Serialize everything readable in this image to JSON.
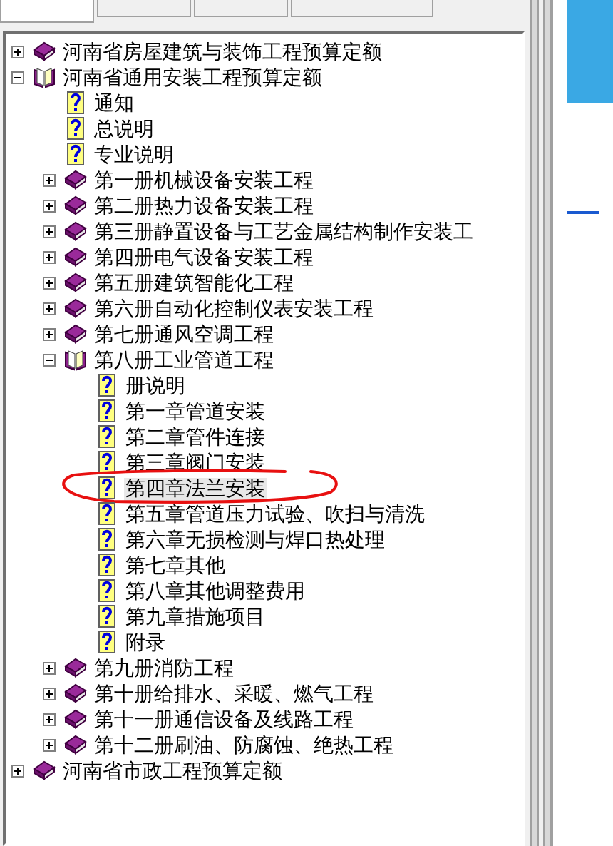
{
  "tabs": [
    {
      "selected": true
    },
    {
      "selected": false
    },
    {
      "selected": false
    },
    {
      "selected": false
    }
  ],
  "tree": [
    {
      "label": "河南省房屋建筑与装饰工程预算定额",
      "kind": "book",
      "expanded": false,
      "selected": false,
      "circled": false
    },
    {
      "label": "河南省通用安装工程预算定额",
      "kind": "book",
      "expanded": true,
      "selected": false,
      "circled": false,
      "children": [
        {
          "label": "通知",
          "kind": "page",
          "selected": false,
          "circled": false
        },
        {
          "label": "总说明",
          "kind": "page",
          "selected": false,
          "circled": false
        },
        {
          "label": "专业说明",
          "kind": "page",
          "selected": false,
          "circled": false
        },
        {
          "label": "第一册机械设备安装工程",
          "kind": "book",
          "expanded": false,
          "selected": false,
          "circled": false
        },
        {
          "label": "第二册热力设备安装工程",
          "kind": "book",
          "expanded": false,
          "selected": false,
          "circled": false
        },
        {
          "label": "第三册静置设备与工艺金属结构制作安装工",
          "kind": "book",
          "expanded": false,
          "selected": false,
          "circled": false
        },
        {
          "label": "第四册电气设备安装工程",
          "kind": "book",
          "expanded": false,
          "selected": false,
          "circled": false
        },
        {
          "label": "第五册建筑智能化工程",
          "kind": "book",
          "expanded": false,
          "selected": false,
          "circled": false
        },
        {
          "label": "第六册自动化控制仪表安装工程",
          "kind": "book",
          "expanded": false,
          "selected": false,
          "circled": false
        },
        {
          "label": "第七册通风空调工程",
          "kind": "book",
          "expanded": false,
          "selected": false,
          "circled": false
        },
        {
          "label": "第八册工业管道工程",
          "kind": "book",
          "expanded": true,
          "selected": false,
          "circled": false,
          "children": [
            {
              "label": "册说明",
              "kind": "page",
              "selected": false,
              "circled": false
            },
            {
              "label": "第一章管道安装",
              "kind": "page",
              "selected": false,
              "circled": false
            },
            {
              "label": "第二章管件连接",
              "kind": "page",
              "selected": false,
              "circled": false
            },
            {
              "label": "第三章阀门安装",
              "kind": "page",
              "selected": false,
              "circled": false
            },
            {
              "label": "第四章法兰安装",
              "kind": "page",
              "selected": true,
              "circled": true
            },
            {
              "label": "第五章管道压力试验、吹扫与清洗",
              "kind": "page",
              "selected": false,
              "circled": false
            },
            {
              "label": "第六章无损检测与焊口热处理",
              "kind": "page",
              "selected": false,
              "circled": false
            },
            {
              "label": "第七章其他",
              "kind": "page",
              "selected": false,
              "circled": false
            },
            {
              "label": "第八章其他调整费用",
              "kind": "page",
              "selected": false,
              "circled": false
            },
            {
              "label": "第九章措施项目",
              "kind": "page",
              "selected": false,
              "circled": false
            },
            {
              "label": "附录",
              "kind": "page",
              "selected": false,
              "circled": false
            }
          ]
        },
        {
          "label": "第九册消防工程",
          "kind": "book",
          "expanded": false,
          "selected": false,
          "circled": false
        },
        {
          "label": "第十册给排水、采暖、燃气工程",
          "kind": "book",
          "expanded": false,
          "selected": false,
          "circled": false
        },
        {
          "label": "第十一册通信设备及线路工程",
          "kind": "book",
          "expanded": false,
          "selected": false,
          "circled": false
        },
        {
          "label": "第十二册刷油、防腐蚀、绝热工程",
          "kind": "book",
          "expanded": false,
          "selected": false,
          "circled": false
        }
      ]
    },
    {
      "label": "河南省市政工程预算定额",
      "kind": "book",
      "expanded": false,
      "selected": false,
      "circled": false
    }
  ]
}
